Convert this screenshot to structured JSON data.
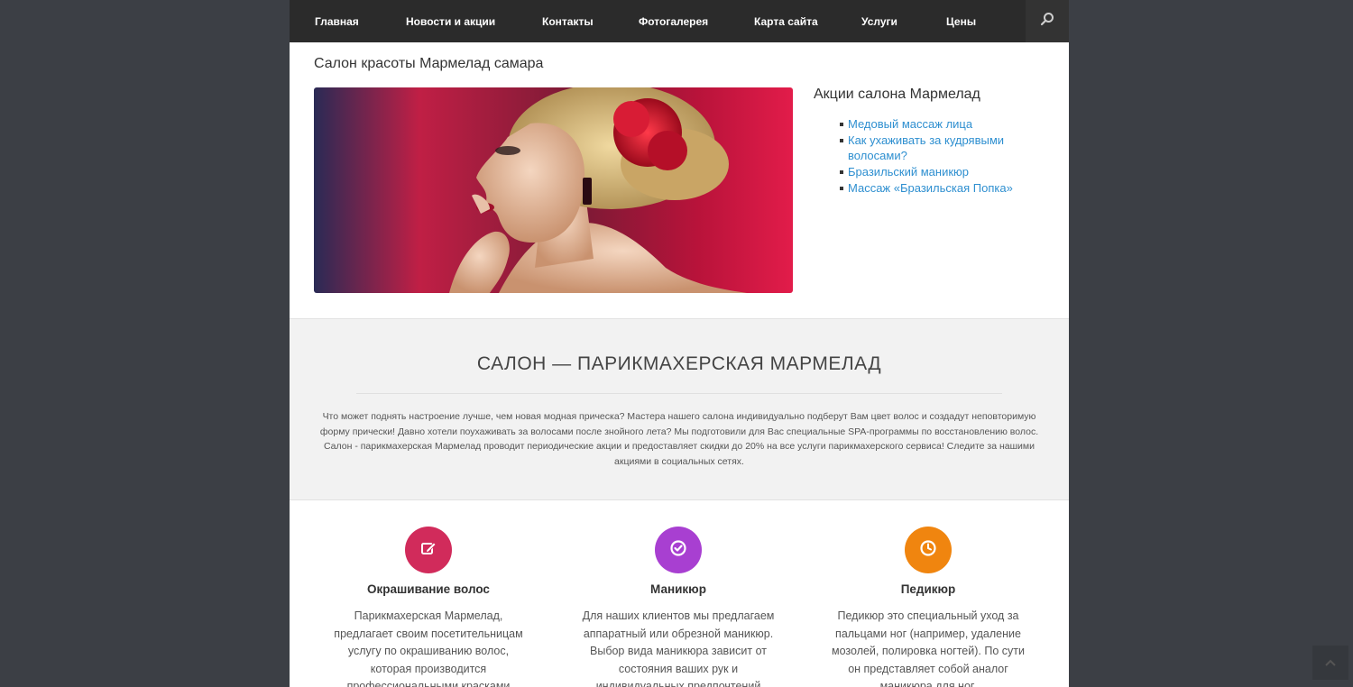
{
  "nav": {
    "items": [
      "Главная",
      "Новости и акции",
      "Контакты",
      "Фотогалерея",
      "Карта сайта",
      "Услуги",
      "Цены"
    ],
    "search_icon": "search-icon"
  },
  "site_title": "Салон красоты Мармелад самара",
  "sidebar": {
    "title": "Акции салона Мармелад",
    "links": [
      "Медовый массаж лица",
      "Как ухаживать за кудрявыми волосами?",
      "Бразильский маникюр",
      "Массаж «Бразильская Попка»"
    ]
  },
  "about": {
    "title": "САЛОН — ПАРИКМАХЕРСКАЯ МАРМЕЛАД",
    "text": "Что может поднять настроение лучше, чем новая модная прическа? Мастера нашего салона индивидуально подберут Вам цвет волос и создадут неповторимую форму прически! Давно хотели поухаживать за волосами после знойного лета? Мы подготовили для Вас специальные SPA-программы по восстановлению волос. Салон - парикмахерская Мармелад проводит периодические акции и предоставляет скидки до 20% на все услуги парикмахерского сервиса! Следите за нашими акциями в социальных сетях."
  },
  "features": [
    {
      "title": "Окрашивание волос",
      "text": "Парикмахерская Мармелад, предлагает своим посетительницам услугу по окрашиванию волос, которая производится профессиональными красками японской фирмы Lebel.",
      "icon": "edit-icon",
      "color": "#d12b5b"
    },
    {
      "title": "Маникюр",
      "text": "Для наших клиентов мы предлагаем аппаратный или обрезной маникюр. Выбор вида маникюра зависит от состояния ваших рук и индивидуальных предпочтений",
      "icon": "check-circle-icon",
      "color": "#a83fd1"
    },
    {
      "title": "Педикюр",
      "text": "Педикюр это специальный уход за пальцами ног (например, удаление мозолей, полировка ногтей). По сути он представляет собой аналог маникюра для ног.",
      "icon": "clock-icon",
      "color": "#f0850f"
    }
  ],
  "colors": {
    "background": "#3c3f45",
    "nav": "#2b2b2b",
    "link": "#2e8fd0"
  }
}
